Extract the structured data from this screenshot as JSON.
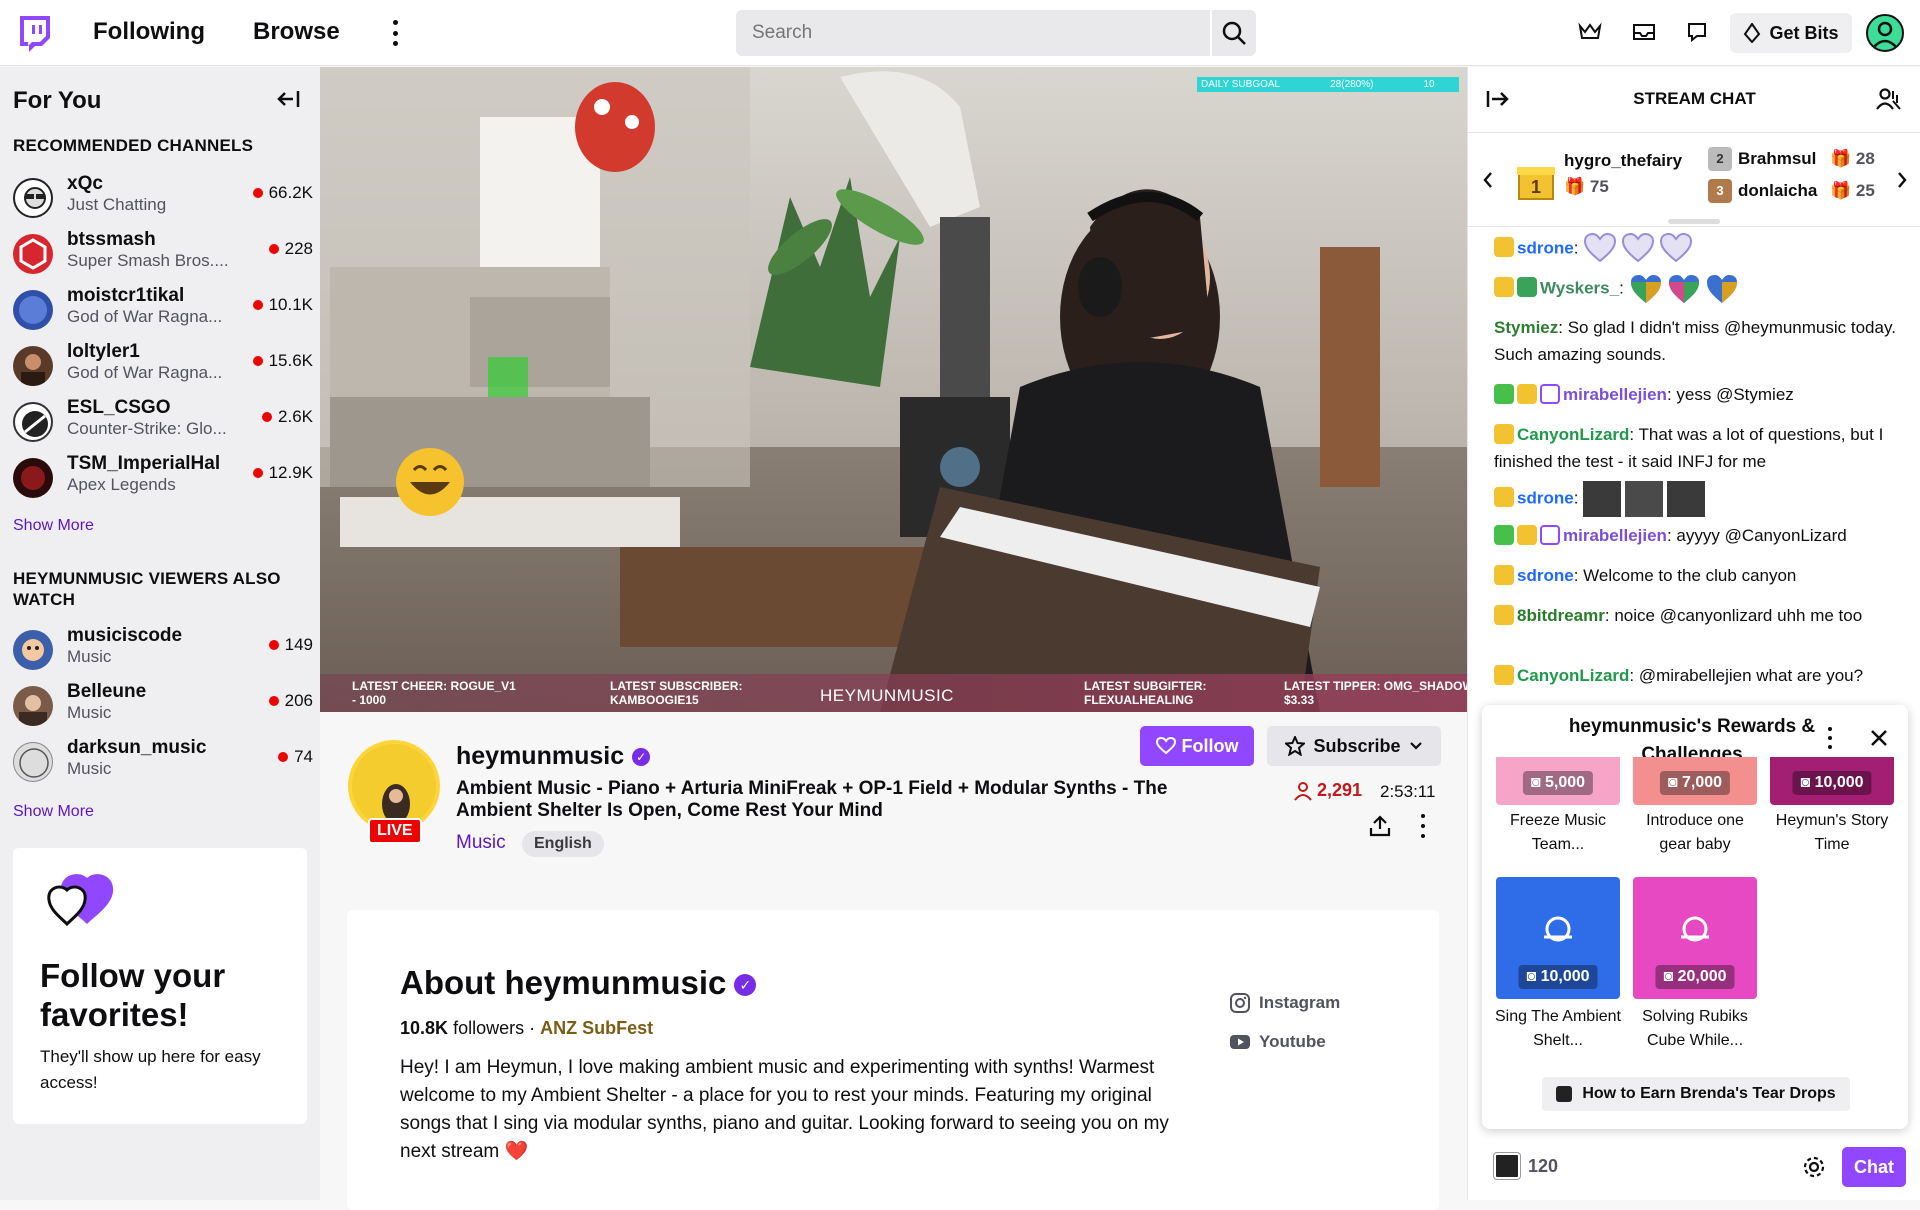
{
  "nav": {
    "following": "Following",
    "browse": "Browse",
    "search_placeholder": "Search",
    "get_bits": "Get Bits"
  },
  "sidebar": {
    "title": "For You",
    "recommended_heading": "RECOMMENDED CHANNELS",
    "recommended": [
      {
        "name": "xQc",
        "game": "Just Chatting",
        "viewers": "66.2K"
      },
      {
        "name": "btssmash",
        "game": "Super Smash Bros....",
        "viewers": "228"
      },
      {
        "name": "moistcr1tikal",
        "game": "God of War Ragna...",
        "viewers": "10.1K"
      },
      {
        "name": "loltyler1",
        "game": "God of War Ragna...",
        "viewers": "15.6K"
      },
      {
        "name": "ESL_CSGO",
        "game": "Counter-Strike: Glo...",
        "viewers": "2.6K"
      },
      {
        "name": "TSM_ImperialHal",
        "game": "Apex Legends",
        "viewers": "12.9K"
      }
    ],
    "show_more": "Show More",
    "also_watch_heading": "HEYMUNMUSIC VIEWERS ALSO WATCH",
    "also_watch": [
      {
        "name": "musiciscode",
        "game": "Music",
        "viewers": "149"
      },
      {
        "name": "Belleune",
        "game": "Music",
        "viewers": "206"
      },
      {
        "name": "darksun_music",
        "game": "Music",
        "viewers": "74"
      }
    ],
    "follow_card": {
      "title": "Follow your favorites!",
      "text": "They'll show up here for easy access!"
    }
  },
  "video_overlay": {
    "subgoal_label": "DAILY SUBGOAL",
    "subgoal_value": "28(280%)",
    "subgoal_target": "10",
    "latest_cheer": "LATEST CHEER: ROGUE_V1\n- 1000",
    "latest_subscriber": "LATEST SUBSCRIBER:\nKAMBOOGIE15",
    "brand": "HEYMUNMUSIC",
    "latest_subgifter": "LATEST SUBGIFTER:\nFLEXUALHEALING",
    "latest_tipper": "LATEST TIPPER: OMG_SHADOW -\n$3.33"
  },
  "stream": {
    "channel": "heymunmusic",
    "live": "LIVE",
    "title": "Ambient Music - Piano + Arturia MiniFreak + OP-1 Field + Modular Synths - The Ambient Shelter Is Open, Come Rest Your Mind",
    "category": "Music",
    "tag": "English",
    "follow": "Follow",
    "subscribe": "Subscribe",
    "viewers": "2,291",
    "uptime": "2:53:11"
  },
  "about": {
    "title": "About heymunmusic",
    "followers_count": "10.8K",
    "followers_label": "followers",
    "separator": "·",
    "team": "ANZ SubFest",
    "bio": "Hey! I am Heymun, I love making ambient music and experimenting with synths! Warmest welcome to my Ambient Shelter - a place for you to rest your minds. Featuring my original songs that I sing via modular synths, piano and guitar. Looking forward to seeing you on my next stream ❤️",
    "links": [
      {
        "label": "Instagram",
        "icon": "instagram-icon"
      },
      {
        "label": "Youtube",
        "icon": "youtube-icon"
      }
    ]
  },
  "chat": {
    "title": "STREAM CHAT",
    "gifters": [
      {
        "name": "hygro_thefairy",
        "count": "75",
        "rank": "1"
      },
      {
        "name": "Brahmsul",
        "count": "28",
        "rank": "2"
      },
      {
        "name": "donlaicha",
        "count": "25",
        "rank": "3"
      }
    ],
    "messages": [
      {
        "user": "sdrone",
        "text": "",
        "color": "#1e69ff",
        "emotes": 3
      },
      {
        "user": "Wyskers_",
        "text": "",
        "color": "#3d8b5f",
        "emotes": 3
      },
      {
        "user": "Stymiez",
        "text": "So glad I didn't miss @heymunmusic today. Such amazing sounds.",
        "color": "#2e7d32"
      },
      {
        "user": "mirabellejien",
        "text": "yess @Stymiez",
        "color": "#7b4fd6"
      },
      {
        "user": "CanyonLizard",
        "text": "That was a lot of questions, but I finished the test - it said INFJ for me",
        "color": "#1f9a48"
      },
      {
        "user": "sdrone",
        "text": "",
        "color": "#1e69ff",
        "emotes": 3
      },
      {
        "user": "mirabellejien",
        "text": "ayyyy @CanyonLizard",
        "color": "#7b4fd6"
      },
      {
        "user": "sdrone",
        "text": "Welcome to the club canyon",
        "color": "#1e69ff"
      },
      {
        "user": "8bitdreamr",
        "text": "noice @canyonlizard uhh me too",
        "color": "#2a7b2a"
      },
      {
        "user": "CanyonLizard",
        "text": "@mirabellejien what are you?",
        "color": "#1f9a48"
      }
    ],
    "rewards": {
      "title": "heymunmusic's Rewards & Challenges",
      "items": [
        {
          "cost": "5,000",
          "label": "Freeze Music Team...",
          "color": "#f6a5c8"
        },
        {
          "cost": "7,000",
          "label": "Introduce one gear baby",
          "color": "#f38f8f"
        },
        {
          "cost": "10,000",
          "label": "Heymun's Story Time",
          "color": "#a31f73"
        },
        {
          "cost": "10,000",
          "label": "Sing The Ambient Shelt...",
          "color": "#2f6de8"
        },
        {
          "cost": "20,000",
          "label": "Solving Rubiks Cube While...",
          "color": "#e649c2"
        }
      ],
      "footer": "How to Earn Brenda's Tear Drops"
    },
    "points": "120",
    "chat_button": "Chat"
  }
}
